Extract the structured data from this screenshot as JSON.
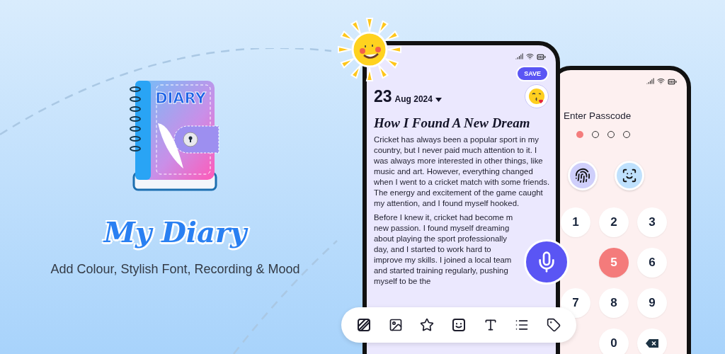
{
  "brand": {
    "logo_text": "DIARY",
    "title": "My Diary",
    "tagline": "Add Colour, Stylish Font, Recording & Mood"
  },
  "editor": {
    "save_label": "SAVE",
    "day": "23",
    "month_year": "Aug 2024",
    "title": "How I Found A New Dream",
    "paragraphs": [
      "Cricket has always been a popular sport in my country, but I never paid much attention to it. I was always more interested in other things, like music and art. However, everything changed when I went to a cricket match with some friends. The energy and excitement of the game caught my attention, and I found myself hooked.",
      "Before I knew it, cricket had become m new passion. I found myself dreaming about playing the sport professionally day, and I started to work hard to improve my skills. I joined a local team and started training regularly, pushing myself to be the"
    ]
  },
  "toolbar": [
    {
      "kind": "pattern"
    },
    {
      "kind": "image"
    },
    {
      "kind": "star"
    },
    {
      "kind": "mood"
    },
    {
      "kind": "text"
    },
    {
      "kind": "list"
    },
    {
      "kind": "tag"
    }
  ],
  "passcode": {
    "prompt": "Enter Passcode",
    "dots": [
      {
        "filled": true
      },
      {
        "filled": false
      },
      {
        "filled": false
      },
      {
        "filled": false
      }
    ],
    "biometrics": [
      {
        "kind": "fingerprint"
      },
      {
        "kind": "face"
      }
    ],
    "keys": [
      {
        "kind": "digit",
        "label": "1",
        "selected": false
      },
      {
        "kind": "digit",
        "label": "2",
        "selected": false
      },
      {
        "kind": "digit",
        "label": "3",
        "selected": false
      },
      {
        "kind": "empty"
      },
      {
        "kind": "digit",
        "label": "5",
        "selected": true
      },
      {
        "kind": "digit",
        "label": "6",
        "selected": false
      },
      {
        "kind": "digit",
        "label": "7",
        "selected": false
      },
      {
        "kind": "digit",
        "label": "8",
        "selected": false
      },
      {
        "kind": "digit",
        "label": "9",
        "selected": false
      },
      {
        "kind": "empty"
      },
      {
        "kind": "digit",
        "label": "0",
        "selected": false
      },
      {
        "kind": "backspace",
        "selected": false
      }
    ]
  }
}
